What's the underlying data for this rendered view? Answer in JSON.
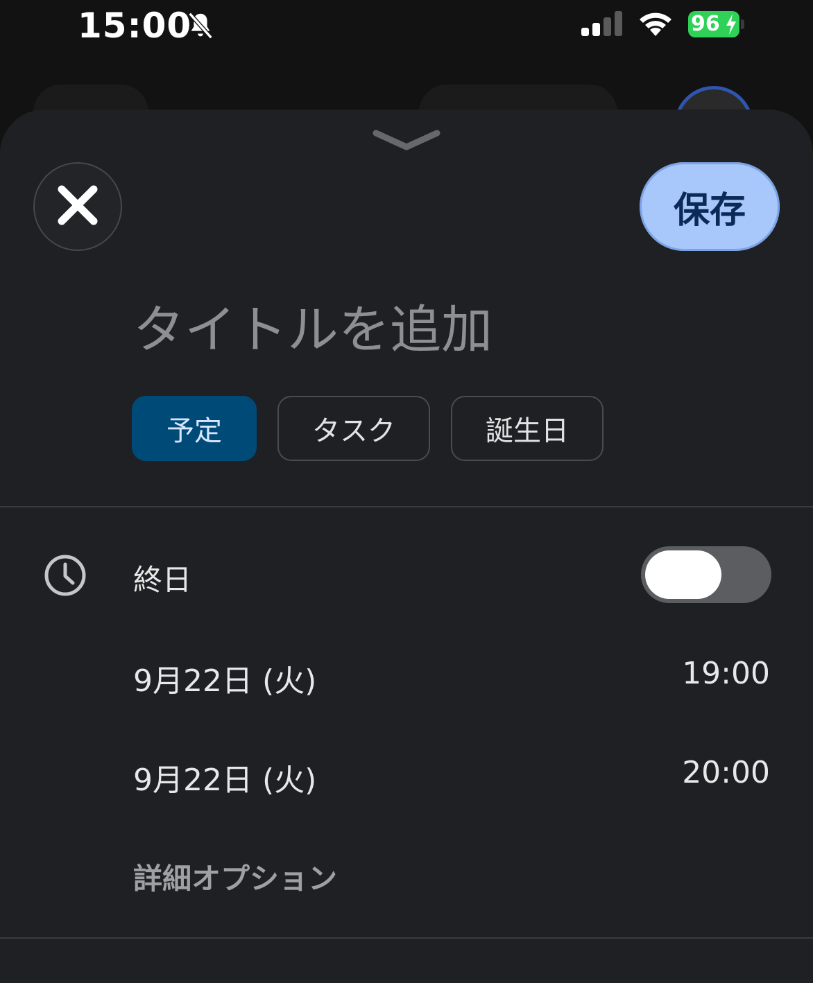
{
  "status_bar": {
    "time": "15:00",
    "battery": "96"
  },
  "sheet": {
    "save_label": "保存",
    "title_placeholder": "タイトルを追加",
    "chips": [
      "予定",
      "タスク",
      "誕生日"
    ],
    "all_day_label": "終日",
    "start": {
      "date": "9月22日 (火)",
      "time": "19:00"
    },
    "end": {
      "date": "9月22日 (火)",
      "time": "20:00"
    },
    "more_options": "詳細オプション"
  },
  "colors": {
    "sheet_bg": "#1f2023",
    "save_bg": "#a8c7fa",
    "selected_chip_bg": "#004a77",
    "battery": "#30d158"
  },
  "icons": [
    "bell-slash-icon",
    "signal-icon",
    "wifi-icon",
    "battery-icon",
    "chevron-down-icon",
    "close-icon",
    "clock-icon"
  ]
}
